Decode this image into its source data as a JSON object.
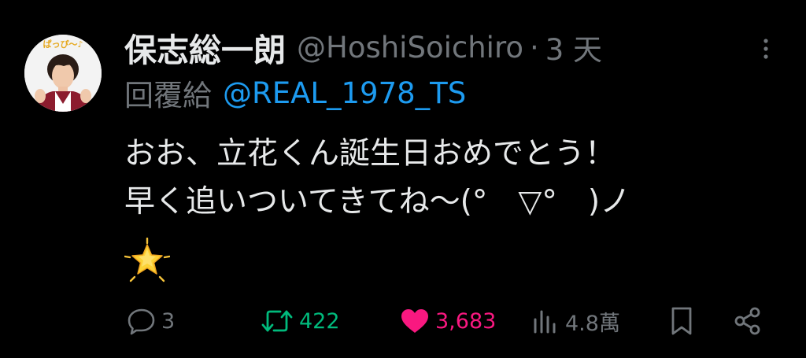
{
  "tweet": {
    "author": {
      "display_name": "保志総一朗",
      "handle": "@HoshiSoichiro",
      "avatar_text": "ぱっぴ〜♪"
    },
    "separator": "·",
    "timestamp": "3 天",
    "reply_prefix": "回覆給",
    "reply_to": "@REAL_1978_TS",
    "text_lines": [
      "おお、立花くん誕生日おめでとう！",
      "早く追いついてきてね〜(°　▽°　)ノ"
    ],
    "emoji": "star-icon",
    "stats": {
      "replies": "3",
      "retweets": "422",
      "likes": "3,683",
      "views": "4.8萬"
    }
  },
  "icons": {
    "reply": "reply-icon",
    "retweet": "retweet-icon",
    "like": "heart-icon",
    "views": "views-icon",
    "bookmark": "bookmark-icon",
    "share": "share-icon",
    "more": "more-icon"
  },
  "colors": {
    "background": "#000000",
    "text_primary": "#e7e9ea",
    "text_secondary": "#71767b",
    "link": "#1d9bf0",
    "retweet_active": "#00ba7c",
    "like_active": "#f91880"
  }
}
